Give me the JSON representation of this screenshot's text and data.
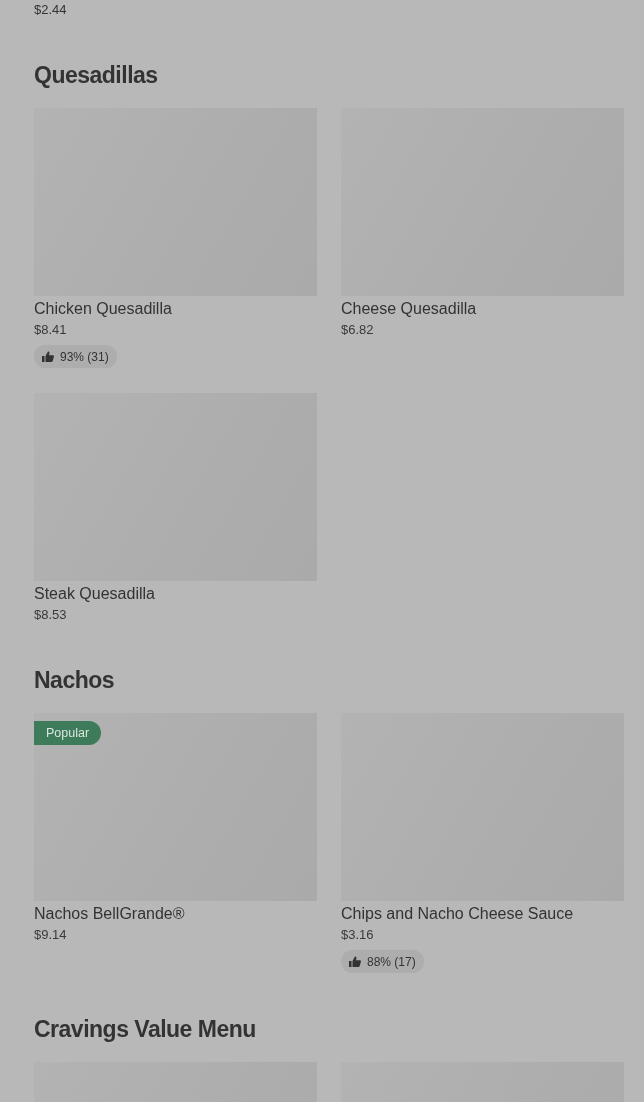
{
  "previous_section_tail": {
    "price": "$2.44"
  },
  "sections": [
    {
      "title": "Quesadillas",
      "items": [
        {
          "kind": "item",
          "name": "Chicken Quesadilla",
          "price": "$8.41",
          "rating": "93% (31)"
        },
        {
          "kind": "item",
          "name": "Cheese Quesadilla",
          "price": "$6.82"
        },
        {
          "kind": "item",
          "name": "Steak Quesadilla",
          "price": "$8.53"
        }
      ]
    },
    {
      "title": "Nachos",
      "items": [
        {
          "kind": "item",
          "name": "Nachos BellGrande®",
          "price": "$9.14",
          "tag": "Popular"
        },
        {
          "kind": "item",
          "name": "Chips and Nacho Cheese Sauce",
          "price": "$3.16",
          "rating": "88% (17)"
        }
      ]
    },
    {
      "title": "Cravings Value Menu",
      "items": [
        {
          "kind": "image_only"
        },
        {
          "kind": "image_only"
        }
      ]
    }
  ]
}
